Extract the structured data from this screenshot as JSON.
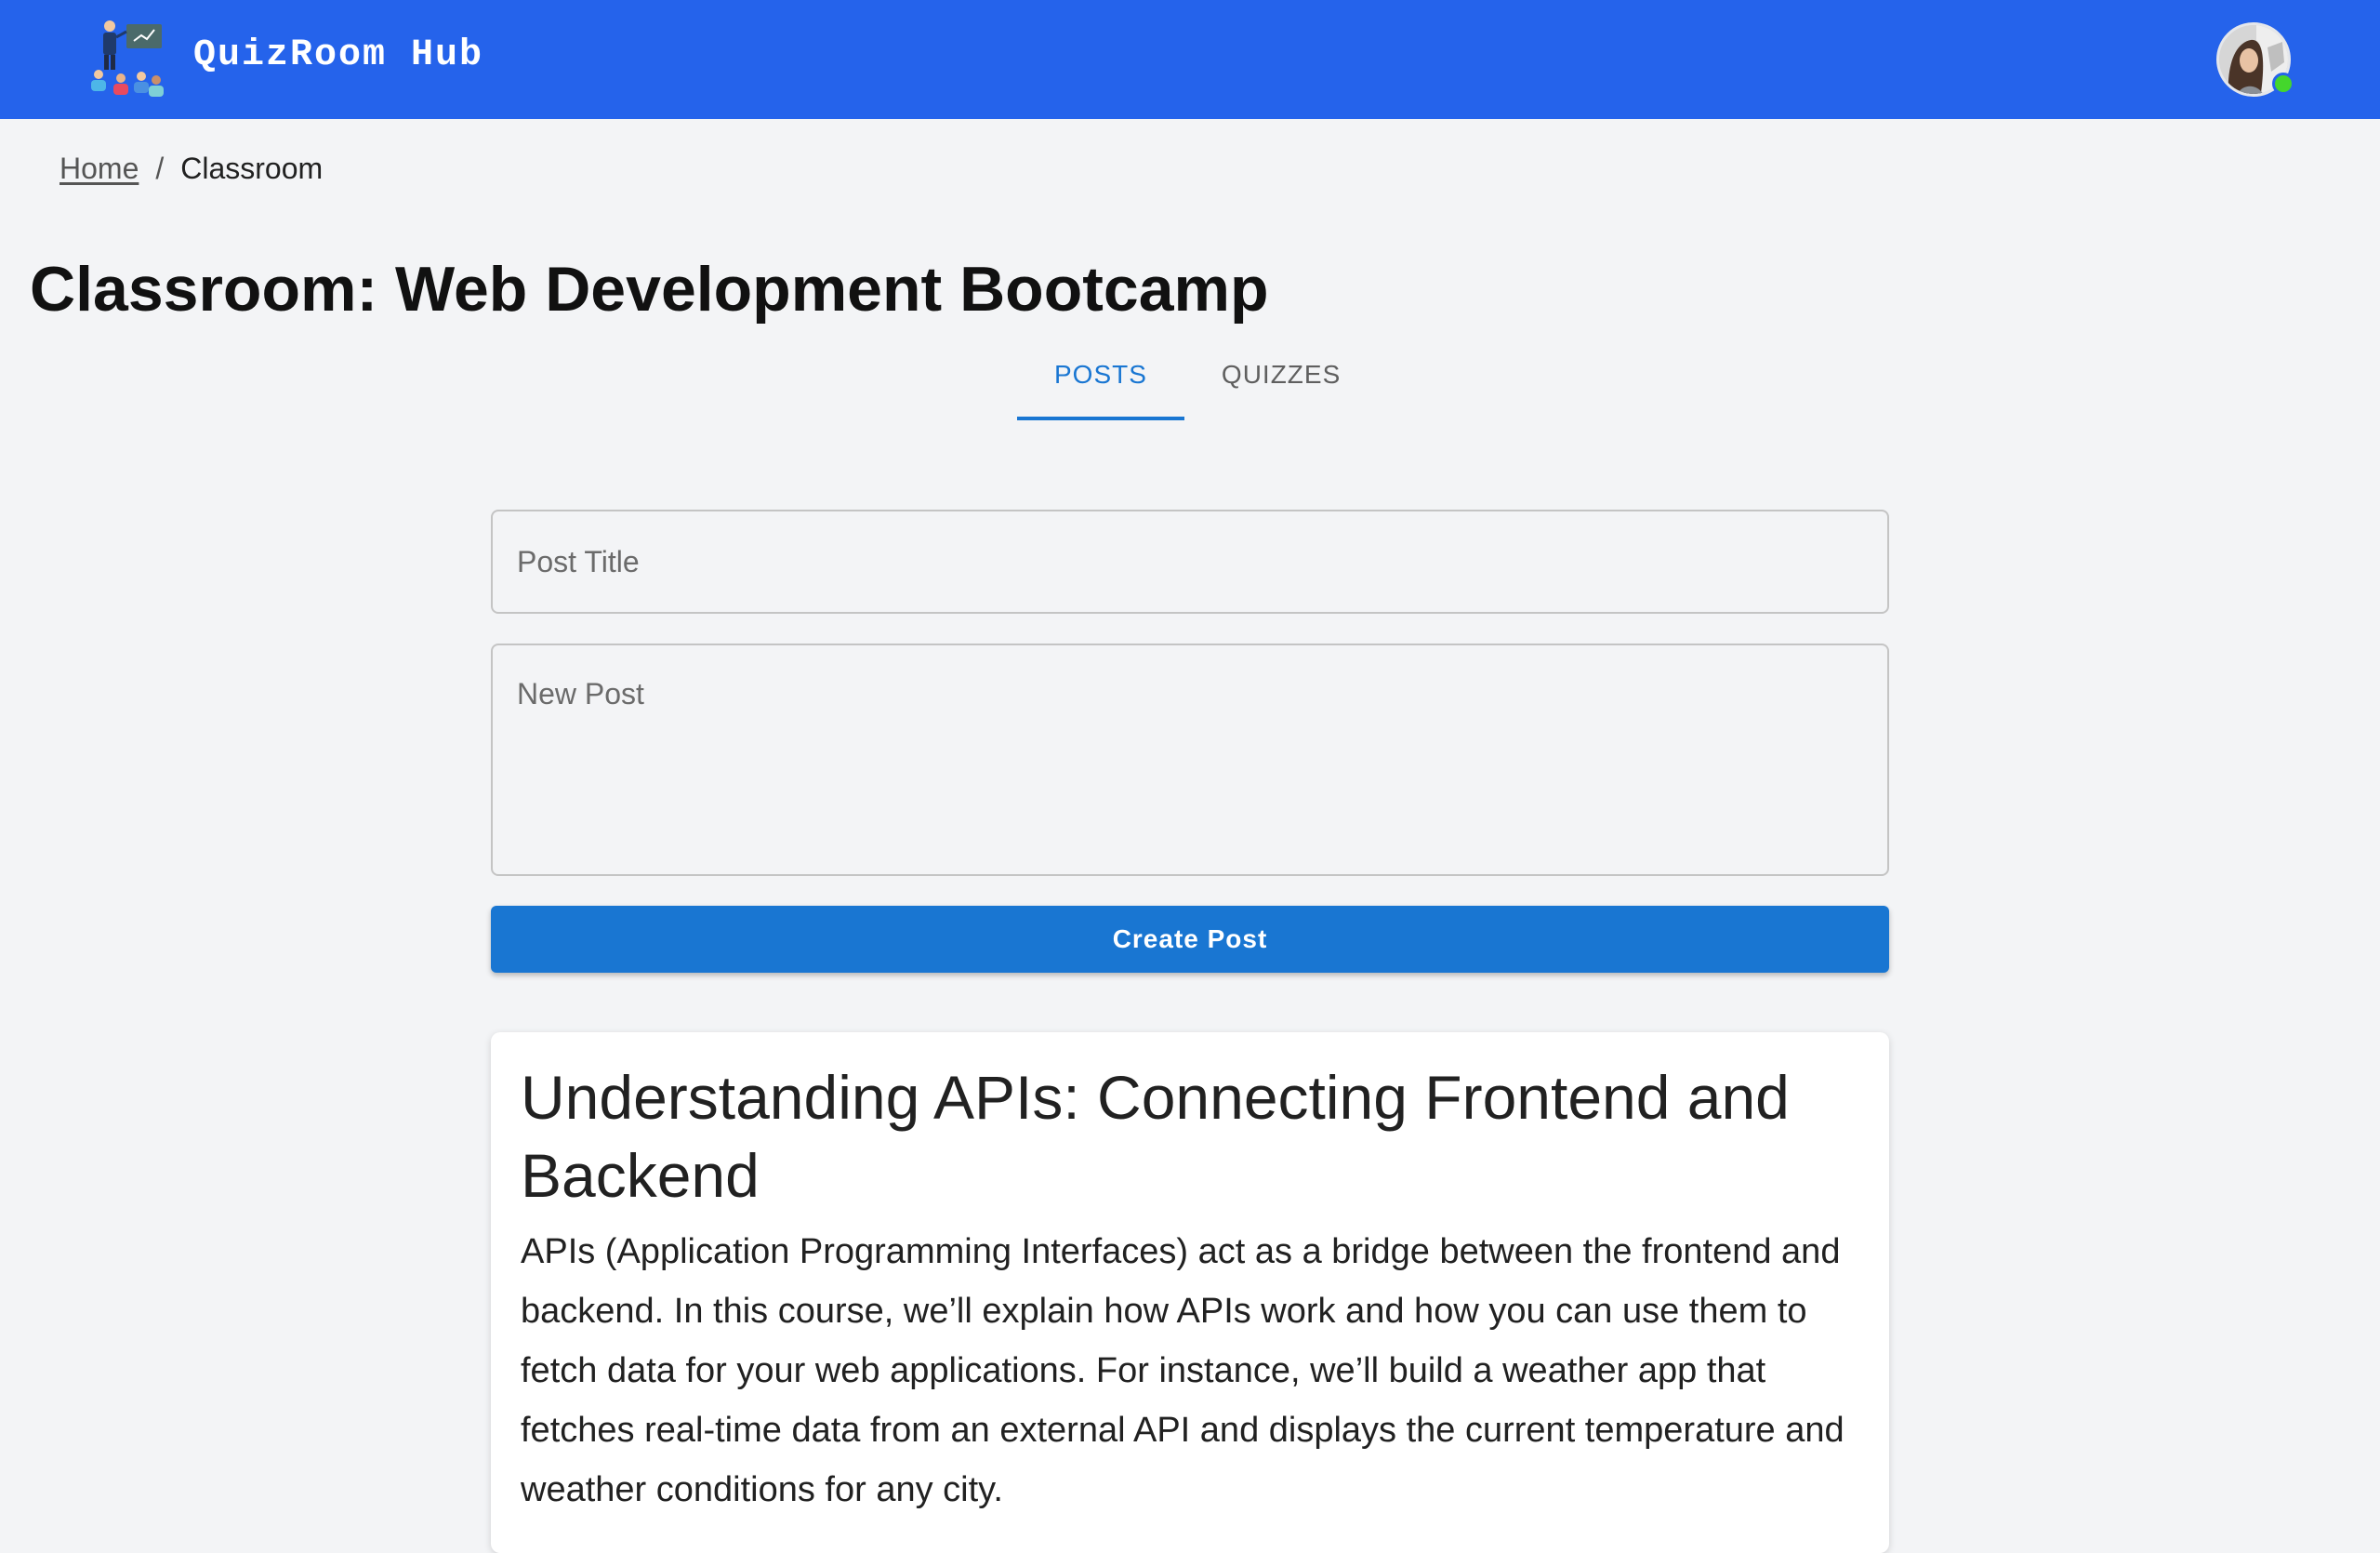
{
  "app": {
    "brand": "QuizRoom Hub"
  },
  "breadcrumb": {
    "home": "Home",
    "separator": "/",
    "current": "Classroom"
  },
  "page": {
    "title": "Classroom: Web Development Bootcamp"
  },
  "tabs": [
    {
      "label": "POSTS",
      "active": true
    },
    {
      "label": "QUIZZES",
      "active": false
    }
  ],
  "form": {
    "title_placeholder": "Post Title",
    "title_value": "",
    "body_placeholder": "New Post",
    "body_value": "",
    "submit_label": "Create Post"
  },
  "posts": [
    {
      "title": "Understanding APIs: Connecting Frontend and Backend",
      "body": "APIs (Application Programming Interfaces) act as a bridge between the frontend and backend. In this course, we’ll explain how APIs work and how you can use them to fetch data for your web applications. For instance, we’ll build a weather app that fetches real-time data from an external API and displays the current temperature and weather conditions for any city."
    }
  ],
  "colors": {
    "appbar": "#2563eb",
    "accent": "#1976d2",
    "background": "#f3f4f6",
    "online": "#44d62c"
  },
  "icons": {
    "logo": "classroom-teacher-icon",
    "avatar": "user-avatar",
    "status": "online-status-dot"
  }
}
